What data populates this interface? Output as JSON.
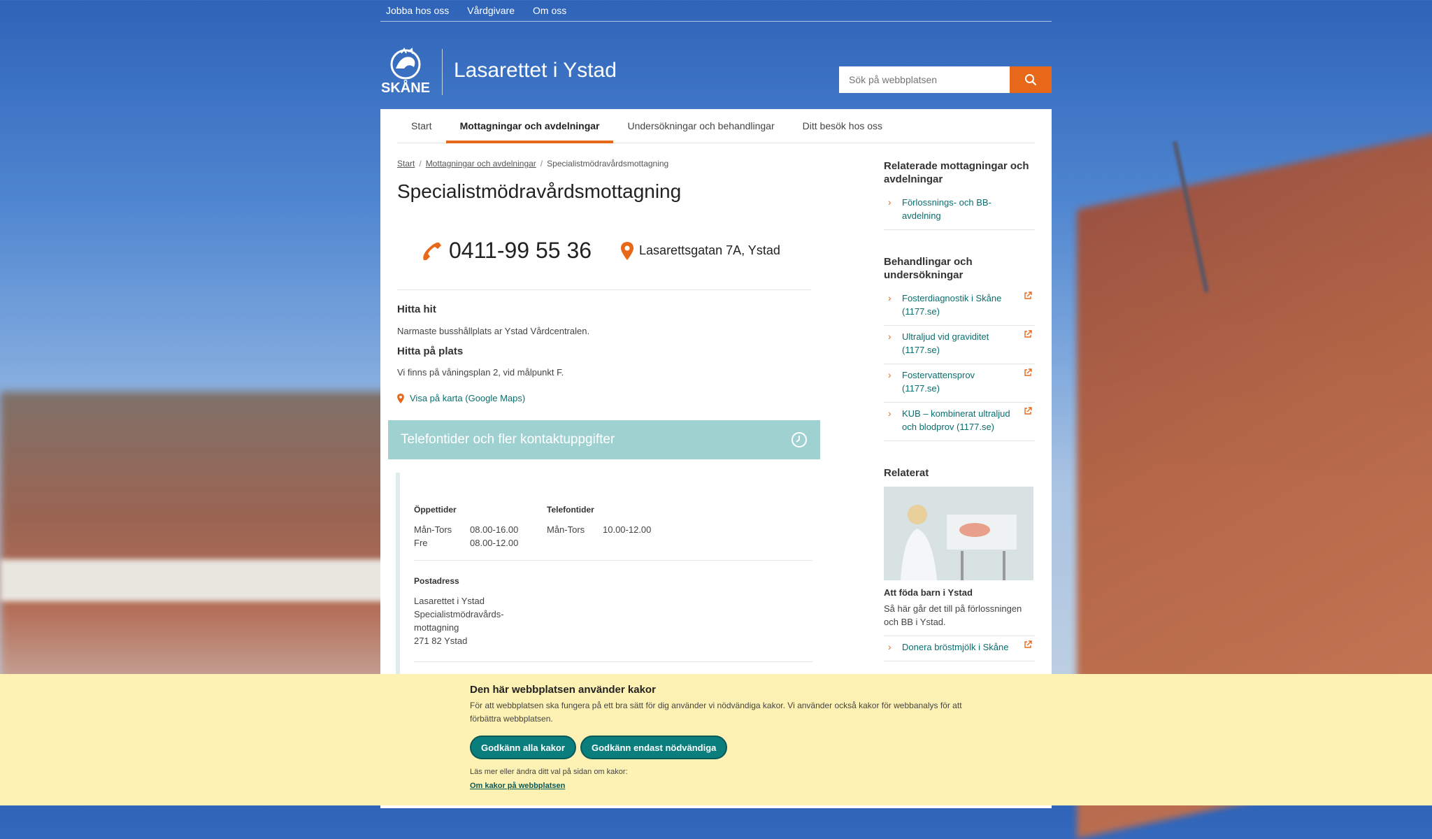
{
  "toplinks": [
    "Jobba hos oss",
    "Vårdgivare",
    "Om oss"
  ],
  "header": {
    "logo_text": "SKÅNE",
    "site_title": "Lasarettet i Ystad",
    "search_placeholder": "Sök på webbplatsen"
  },
  "nav": {
    "items": [
      "Start",
      "Mottagningar och avdelningar",
      "Undersökningar och behandlingar",
      "Ditt besök hos oss"
    ],
    "active": "Mottagningar och avdelningar"
  },
  "breadcrumb": {
    "items": [
      "Start",
      "Mottagningar och avdelningar"
    ],
    "current": "Specialistmödravårdsmottagning",
    "separator": "/"
  },
  "page_title": "Specialistmödravårdsmottagning",
  "contact": {
    "phone": "0411-99 55 36",
    "address": "Lasarettsgatan 7A, Ystad"
  },
  "directions": {
    "heading1": "Hitta hit",
    "text1": "Narmaste busshållplats ar Ystad Vårdcentralen.",
    "heading2": "Hitta på plats",
    "text2": "Vi finns på våningsplan 2, vid målpunkt F.",
    "map_link": "Visa på karta (Google Maps)"
  },
  "accordion": {
    "title": "Telefontider och fler kontaktuppgifter",
    "open_hours_heading": "Öppettider",
    "open_hours": [
      {
        "days": "Mån-Tors",
        "time": "08.00-16.00"
      },
      {
        "days": "Fre",
        "time": "08.00-12.00"
      }
    ],
    "phone_hours_heading": "Telefontider",
    "phone_hours": [
      {
        "days": "Mån-Tors",
        "time": "10.00-12.00"
      }
    ],
    "postal_heading": "Postadress",
    "postal_lines": [
      "Lasarettet i Ystad",
      "Specialistmödravårds-",
      "mottagning",
      "271 82 Ystad"
    ]
  },
  "sidebar": {
    "related_units_heading": "Relaterade mottagningar och avdelningar",
    "related_units": [
      "Förlossnings- och BB-avdelning"
    ],
    "treatments_heading": "Behandlingar och undersökningar",
    "treatments": [
      "Fosterdiagnostik i Skåne (1177.se)",
      "Ultraljud vid graviditet (1177.se)",
      "Fostervattensprov (1177.se)",
      "KUB – kombinerat ultraljud och blodprov (1177.se)"
    ],
    "related_heading": "Relaterat",
    "related_card_title": "Att föda barn i Ystad",
    "related_card_text": "Så här går det till på förlossningen och BB i Ystad.",
    "related_extra": "Donera bröstmjölk i Skåne"
  },
  "cookie": {
    "heading": "Den här webbplatsen använder kakor",
    "text": "För att webbplatsen ska fungera på ett bra sätt för dig använder vi nödvändiga kakor. Vi använder också kakor för webbanalys för att förbättra webbplatsen.",
    "accept_all": "Godkänn alla kakor",
    "accept_necessary": "Godkänn endast nödvändiga",
    "more_text": "Läs mer eller ändra ditt val på sidan om kakor:",
    "more_link": "Om kakor på webbplatsen"
  },
  "colors": {
    "accent": "#e8681a",
    "teal": "#0b6e6e",
    "accordion": "#9fd1d1",
    "cookie_bg": "#fdf1b3"
  }
}
